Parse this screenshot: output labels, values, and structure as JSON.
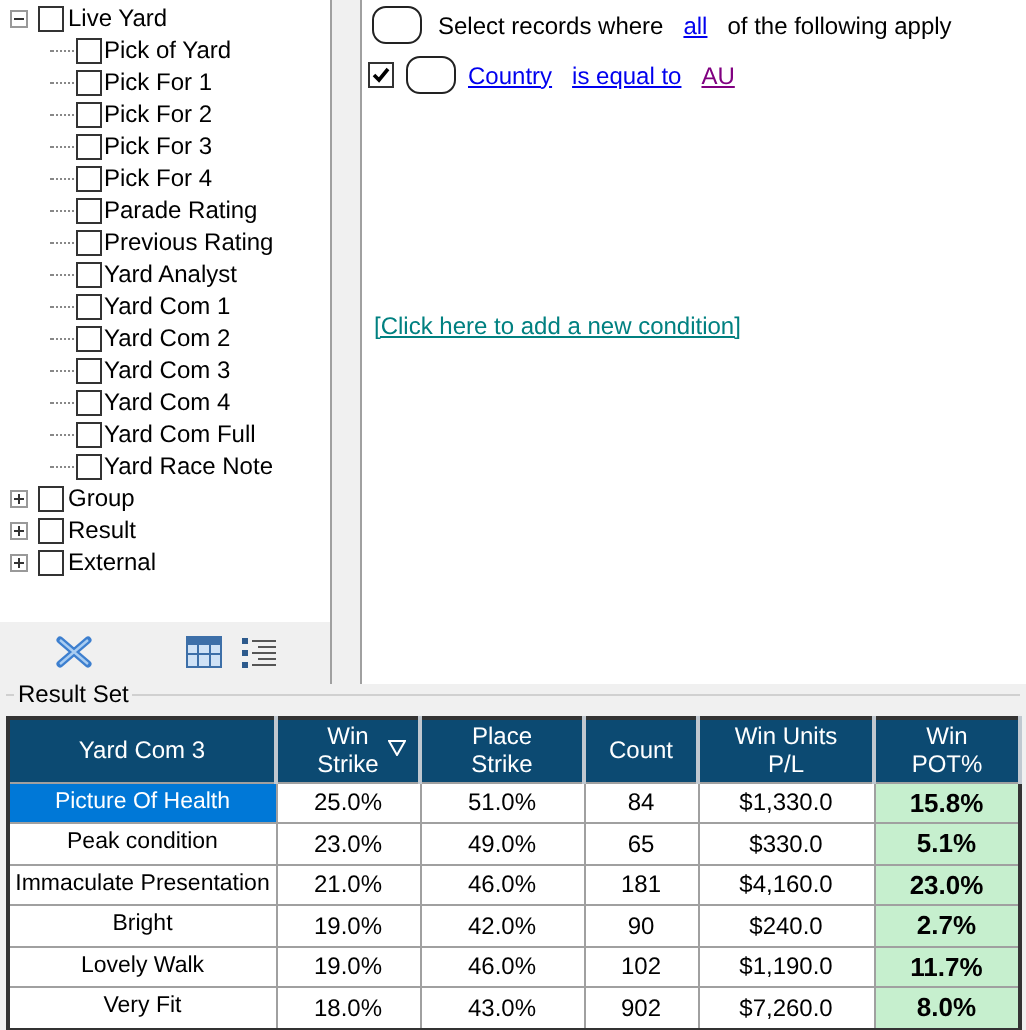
{
  "tree": [
    {
      "label": "Live Yard",
      "checked": false,
      "expanded": true,
      "children": [
        {
          "label": "Pick of Yard",
          "checked": false
        },
        {
          "label": "Pick For 1",
          "checked": false
        },
        {
          "label": "Pick For 2",
          "checked": false
        },
        {
          "label": "Pick For 3",
          "checked": false
        },
        {
          "label": "Pick For 4",
          "checked": false
        },
        {
          "label": "Parade Rating",
          "checked": false
        },
        {
          "label": "Previous Rating",
          "checked": false
        },
        {
          "label": "Yard Analyst",
          "checked": false
        },
        {
          "label": "Yard Com 1",
          "checked": false
        },
        {
          "label": "Yard Com 2",
          "checked": false
        },
        {
          "label": "Yard Com 3",
          "checked": false
        },
        {
          "label": "Yard Com 4",
          "checked": false
        },
        {
          "label": "Yard Com Full",
          "checked": false
        },
        {
          "label": "Yard Race Note",
          "checked": false
        }
      ]
    },
    {
      "label": "Group",
      "checked": false,
      "expanded": false
    },
    {
      "label": "Result",
      "checked": false,
      "expanded": false
    },
    {
      "label": "External",
      "checked": false,
      "expanded": false
    }
  ],
  "conditions": {
    "header": {
      "prefix": "Select records where",
      "quantifier": "all",
      "suffix": "of the following apply"
    },
    "rules": [
      {
        "checked": true,
        "field": "Country",
        "operator": "is equal to",
        "value": "AU"
      }
    ],
    "add_link": "[Click here to add a new condition]"
  },
  "result_set": {
    "title": "Result Set",
    "columns": [
      {
        "lines": [
          "Yard Com 3"
        ],
        "sorted": false
      },
      {
        "lines": [
          "Win",
          "Strike"
        ],
        "sorted": true
      },
      {
        "lines": [
          "Place",
          "Strike"
        ],
        "sorted": false
      },
      {
        "lines": [
          "Count"
        ],
        "sorted": false
      },
      {
        "lines": [
          "Win Units",
          "P/L"
        ],
        "sorted": false
      },
      {
        "lines": [
          "Win",
          "POT%"
        ],
        "sorted": false
      }
    ],
    "rows": [
      {
        "selected": true,
        "cells": [
          "Picture Of Health",
          "25.0%",
          "51.0%",
          "84",
          "$1,330.0",
          "15.8%"
        ]
      },
      {
        "selected": false,
        "cells": [
          "Peak condition",
          "23.0%",
          "49.0%",
          "65",
          "$330.0",
          "5.1%"
        ]
      },
      {
        "selected": false,
        "cells": [
          "Immaculate Presentation",
          "21.0%",
          "46.0%",
          "181",
          "$4,160.0",
          "23.0%"
        ]
      },
      {
        "selected": false,
        "cells": [
          "Bright",
          "19.0%",
          "42.0%",
          "90",
          "$240.0",
          "2.7%"
        ]
      },
      {
        "selected": false,
        "cells": [
          "Lovely Walk",
          "19.0%",
          "46.0%",
          "102",
          "$1,190.0",
          "11.7%"
        ]
      },
      {
        "selected": false,
        "cells": [
          "Very Fit",
          "18.0%",
          "43.0%",
          "902",
          "$7,260.0",
          "8.0%"
        ]
      }
    ]
  }
}
